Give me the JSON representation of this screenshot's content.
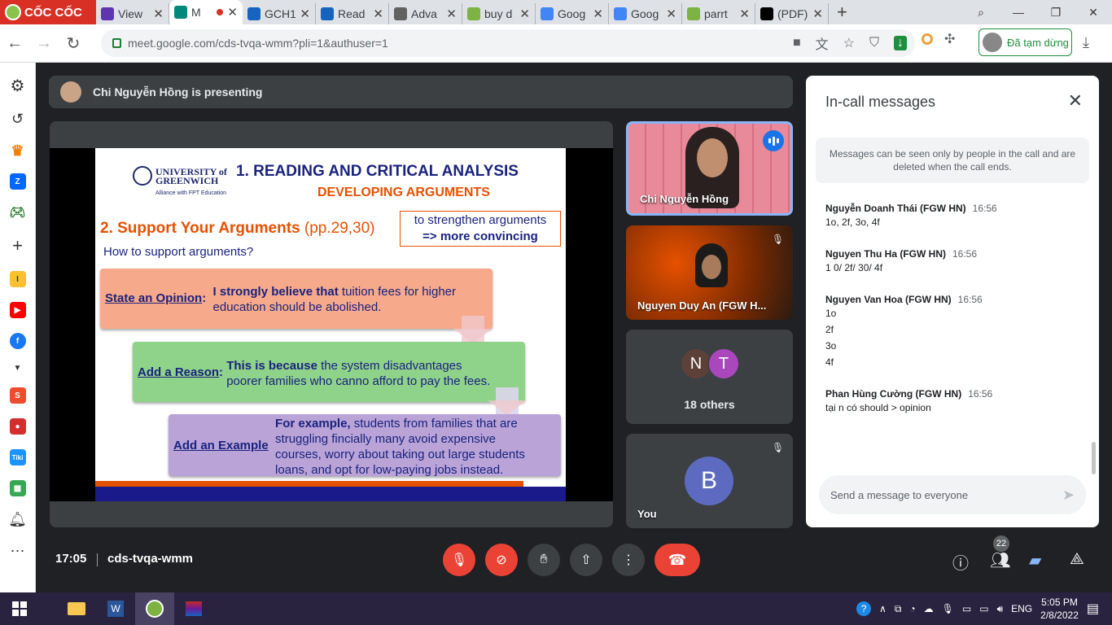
{
  "browser": {
    "brand": "CỐC CỐC",
    "tabs": [
      {
        "title": "View",
        "color": "#5e35b1"
      },
      {
        "title": "M",
        "color": "#00897b",
        "active": true
      },
      {
        "title": "GCH1",
        "color": "#1565c0"
      },
      {
        "title": "Read",
        "color": "#1565c0"
      },
      {
        "title": "Adva",
        "color": "#616161"
      },
      {
        "title": "buy d",
        "color": "#7cb342"
      },
      {
        "title": "Goog",
        "color": "#4285f4"
      },
      {
        "title": "Goog",
        "color": "#4285f4"
      },
      {
        "title": "parrt",
        "color": "#7cb342"
      },
      {
        "title": "(PDF)",
        "color": "#000000"
      }
    ],
    "url": "meet.google.com/cds-tvqa-wmm?pli=1&authuser=1",
    "profile_status": "Đã tạm dừng"
  },
  "presenting": {
    "text": "Chi Nguyễn Hồng is presenting"
  },
  "slide": {
    "university": "UNIVERSITY of GREENWICH",
    "alliance": "Alliance with FPT Education",
    "title": "1. READING AND CRITICAL ANALYSIS",
    "subtitle": "DEVELOPING ARGUMENTS",
    "heading": "2. Support Your Arguments",
    "pages": "(pp.29,30)",
    "box_line1": "to strengthen arguments",
    "box_line2": "=> more convincing",
    "question": "How to support arguments?",
    "opinion_label": "State an Opinion",
    "opinion_bold": "I strongly believe that",
    "opinion_text1": " tuition fees for higher",
    "opinion_text2": "education should be abolished.",
    "reason_label": "Add a Reason",
    "reason_bold": "This is because",
    "reason_text1": " the system disadvantages",
    "reason_text2": "poorer families who canno afford to pay the fees.",
    "example_label": "Add an Example",
    "example_bold": "For example,",
    "example_text1": " students from families that are",
    "example_text2": "struggling fincially many avoid expensive",
    "example_text3": "courses, worry about taking out large students",
    "example_text4": "loans, and opt for low-paying jobs instead."
  },
  "participants": {
    "presenter_name": "Chi Nguyễn Hồng",
    "second_name": "Nguyen Duy An (FGW H...",
    "others_initials": [
      "N",
      "T"
    ],
    "others_label": "18 others",
    "you_initial": "B",
    "you_label": "You"
  },
  "chat": {
    "title": "In-call messages",
    "info": "Messages can be seen only by people in the call and are deleted when the call ends.",
    "messages": [
      {
        "sender": "Nguyễn Doanh Thái (FGW HN)",
        "time": "16:56",
        "lines": [
          "1o, 2f, 3o, 4f"
        ]
      },
      {
        "sender": "Nguyen Thu Ha (FGW HN)",
        "time": "16:56",
        "lines": [
          "1 0/ 2f/ 30/ 4f"
        ]
      },
      {
        "sender": "Nguyen Van Hoa (FGW HN)",
        "time": "16:56",
        "lines": [
          "1o",
          "2f",
          "3o",
          "4f"
        ]
      },
      {
        "sender": "Phan Hùng Cường (FGW HN)",
        "time": "16:56",
        "lines": [
          "tại n có should > opinion"
        ]
      }
    ],
    "placeholder": "Send a message to everyone"
  },
  "meeting": {
    "time": "17:05",
    "code": "cds-tvqa-wmm",
    "people_count": "22"
  },
  "taskbar": {
    "language": "ENG",
    "time": "5:05 PM",
    "date": "2/8/2022"
  }
}
